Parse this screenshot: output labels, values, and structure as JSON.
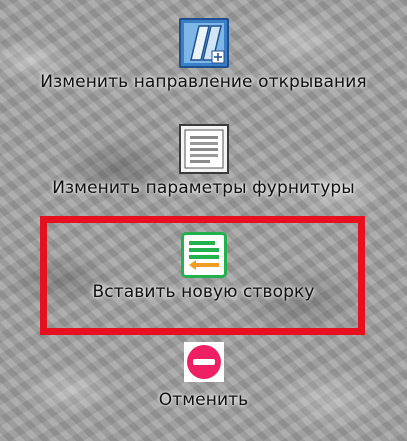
{
  "items": [
    {
      "label": "Изменить направление открывания",
      "icon": "window-sash-icon"
    },
    {
      "label": "Изменить параметры фурнитуры",
      "icon": "document-lines-icon"
    },
    {
      "label": "Вставить новую створку",
      "icon": "insert-lines-icon"
    },
    {
      "label": "Отменить",
      "icon": "cancel-icon"
    }
  ],
  "highlighted_item": "Вставить новую створку",
  "colors": {
    "highlight_border": "#e8101e",
    "insert_icon_green": "#22b14c",
    "insert_icon_orange": "#f39c24",
    "cancel_icon": "#ee1f63",
    "window_icon_blue": "#3d7fc7"
  }
}
